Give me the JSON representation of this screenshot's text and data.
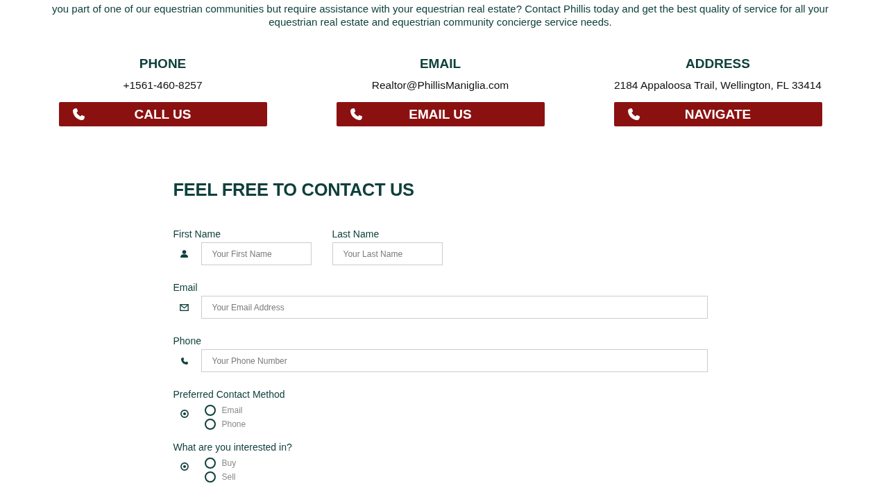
{
  "intro": {
    "text": "you part of one of our equestrian communities but require assistance with your equestrian real estate? Contact Phillis today and get the best quality of service for all your equestrian real estate and equestrian community concierge service needs."
  },
  "contact_cards": [
    {
      "heading": "PHONE",
      "value": "+1561-460-8257",
      "button": "CALL US"
    },
    {
      "heading": "EMAIL",
      "value": "Realtor@PhillisManiglia.com",
      "button": "EMAIL US"
    },
    {
      "heading": "ADDRESS",
      "value": "2184 Appaloosa Trail, Wellington, FL 33414",
      "button": "NAVIGATE"
    }
  ],
  "form": {
    "title": "FEEL FREE TO CONTACT US",
    "fields": [
      {
        "kind": "name",
        "parts": [
          {
            "label": "First Name",
            "placeholder": "Your First Name"
          },
          {
            "label": "Last Name",
            "placeholder": "Your Last Name"
          }
        ]
      },
      {
        "kind": "email",
        "label": "Email",
        "placeholder": "Your Email Address"
      },
      {
        "kind": "phone",
        "label": "Phone",
        "placeholder": "Your Phone Number"
      },
      {
        "kind": "choice",
        "label": "Preferred Contact Method",
        "options": [
          {
            "label": "Email",
            "selected": false
          },
          {
            "label": "Phone",
            "selected": false
          }
        ]
      },
      {
        "kind": "choice",
        "label": "What are you interested in?",
        "options": [
          {
            "label": "Buy",
            "selected": false
          },
          {
            "label": "Sell",
            "selected": false
          }
        ]
      }
    ]
  }
}
